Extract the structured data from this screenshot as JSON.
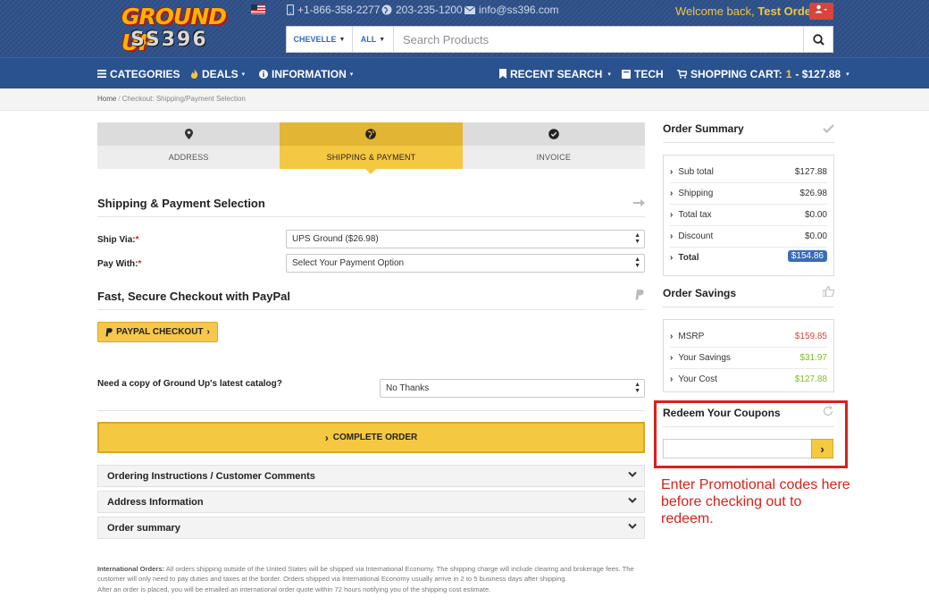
{
  "header": {
    "logo_top": "GROUND UP",
    "logo_bottom": "SS396",
    "phone1": "+1-866-358-2277",
    "phone2": "203-235-1200",
    "email": "info@ss396.com",
    "welcome_prefix": "Welcome back,",
    "user_name": "Test Order",
    "search": {
      "vehicle": "CHEVELLE",
      "scope": "ALL",
      "placeholder": "Search Products"
    }
  },
  "nav": {
    "categories": "CATEGORIES",
    "deals": "DEALS",
    "information": "INFORMATION",
    "recent_search": "RECENT SEARCH",
    "tech": "TECH",
    "cart_label": "SHOPPING CART:",
    "cart_count": "1",
    "cart_total": "- $127.88"
  },
  "breadcrumb": {
    "home": "Home",
    "current": "Checkout: Shipping/Payment Selection"
  },
  "steps": [
    {
      "label": "ADDRESS",
      "icon": "map-marker-icon"
    },
    {
      "label": "SHIPPING & PAYMENT",
      "icon": "globe-icon"
    },
    {
      "label": "INVOICE",
      "icon": "check-circle-icon"
    }
  ],
  "shipping": {
    "title": "Shipping & Payment Selection",
    "ship_via_label": "Ship Via:",
    "ship_via_value": "UPS Ground ($26.98)",
    "pay_with_label": "Pay With:",
    "pay_with_value": "Select Your Payment Option",
    "required_mark": "*"
  },
  "paypal": {
    "title": "Fast, Secure Checkout with PayPal",
    "button": "PAYPAL CHECKOUT"
  },
  "catalog": {
    "question": "Need a copy of Ground Up's latest catalog?",
    "value": "No Thanks"
  },
  "complete_button": "COMPLETE ORDER",
  "accordions": [
    "Ordering Instructions / Customer Comments",
    "Address Information",
    "Order summary"
  ],
  "international": {
    "label": "International Orders:",
    "text": " All orders shipping outside of the United States will be shipped via International Economy. The shipping charge will include clearing and brokerage fees. The customer will only need to pay duties and taxes at the border. Orders shipped via International Economy usually arrive in 2 to 5 business days after shipping.",
    "text2": "After an order is placed, you will be emailed an international order quote within 72 hours notifying you of the shipping cost estimate."
  },
  "order_summary": {
    "title": "Order Summary",
    "rows": [
      {
        "label": "Sub total",
        "value": "$127.88"
      },
      {
        "label": "Shipping",
        "value": "$26.98"
      },
      {
        "label": "Total tax",
        "value": "$0.00"
      },
      {
        "label": "Discount",
        "value": "$0.00"
      },
      {
        "label": "Total",
        "value": "$154.86"
      }
    ]
  },
  "order_savings": {
    "title": "Order Savings",
    "rows": [
      {
        "label": "MSRP",
        "value": "$159.85"
      },
      {
        "label": "Your Savings",
        "value": "$31.97"
      },
      {
        "label": "Your Cost",
        "value": "$127.88"
      }
    ]
  },
  "coupons": {
    "title": "Redeem Your Coupons",
    "annotation": "Enter Promotional codes here before checking out to redeem."
  },
  "colors": {
    "header_blue": "#2b4e86",
    "accent_yellow": "#f5c842",
    "annotation_red": "#d6231a",
    "savings_green": "#7fba2a"
  }
}
